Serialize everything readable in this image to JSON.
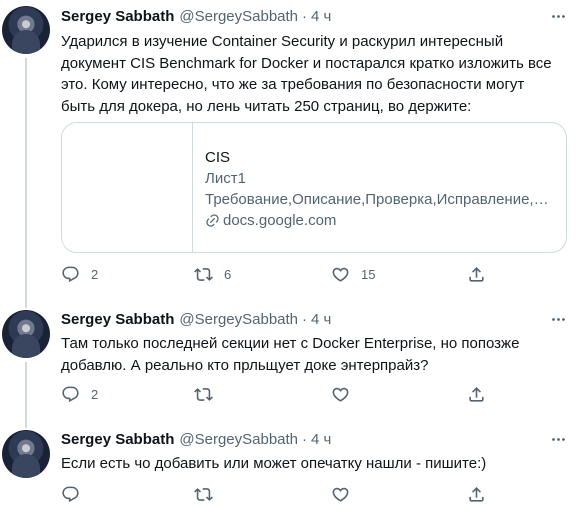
{
  "tweets": [
    {
      "author_name": "Sergey Sabbath",
      "handle": "@SergeySabbath",
      "separator": "·",
      "time": "4 ч",
      "text": "Ударился в изучение Container Security и раскурил интересный документ CIS Benchmark for Docker и постарался кратко изложить все это. Кому интересно, что же за требования по безопасности могут быть для докера, но лень читать 250 страниц, во держите:",
      "card": {
        "title": "CIS",
        "subtitle": "Лист1",
        "description": "Требование,Описание,Проверка,Исправление,…",
        "domain": "docs.google.com",
        "link_icon": "link-icon"
      },
      "replies": "2",
      "retweets": "6",
      "likes": "15"
    },
    {
      "author_name": "Sergey Sabbath",
      "handle": "@SergeySabbath",
      "separator": "·",
      "time": "4 ч",
      "text": "Там только последней секции нет с Docker Enterprise, но попозже добавлю. А реально кто прльщует доке энтерпрайз?",
      "replies": "2",
      "retweets": "",
      "likes": ""
    },
    {
      "author_name": "Sergey Sabbath",
      "handle": "@SergeySabbath",
      "separator": "·",
      "time": "4 ч",
      "text": "Если есть чо добавить или может опечатку нашли - пишите:)",
      "replies": "",
      "retweets": "",
      "likes": ""
    }
  ],
  "icons": {
    "reply": "reply-icon",
    "retweet": "retweet-icon",
    "like": "heart-icon",
    "share": "share-icon",
    "more": "more-icon"
  },
  "colors": {
    "text": "#0f1419",
    "secondary": "#536471",
    "border": "#cfd9de"
  }
}
